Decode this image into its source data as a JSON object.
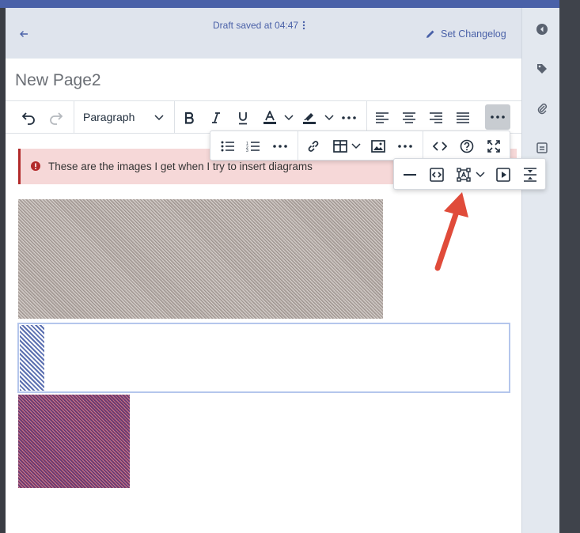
{
  "header": {
    "draft_status": "Draft saved at 04:47",
    "changelog_label": "Set Changelog"
  },
  "page": {
    "title": "New Page2"
  },
  "toolbar": {
    "block_format": "Paragraph",
    "buttons": [
      "undo",
      "redo",
      "bold",
      "italic",
      "underline",
      "text-color",
      "highlight-color",
      "more-formatting",
      "align-left",
      "align-center",
      "align-right",
      "justify",
      "more"
    ]
  },
  "popup_toolbar": {
    "buttons": [
      "bullet-list",
      "numbered-list",
      "more-lists",
      "link",
      "table",
      "image",
      "more-insert",
      "code",
      "help",
      "fullscreen"
    ]
  },
  "insert_menu": {
    "buttons": [
      "horizontal-rule",
      "embed",
      "drawio-diagram",
      "media",
      "page-break"
    ]
  },
  "content": {
    "alert_text": "These are the images I get when I try to insert diagrams"
  },
  "colors": {
    "accent": "#4a61a8",
    "header_bg": "#dfe4ed",
    "alert_bg": "#f6d8d8",
    "alert_border": "#b22a2a",
    "arrow": "#e04b3a"
  }
}
